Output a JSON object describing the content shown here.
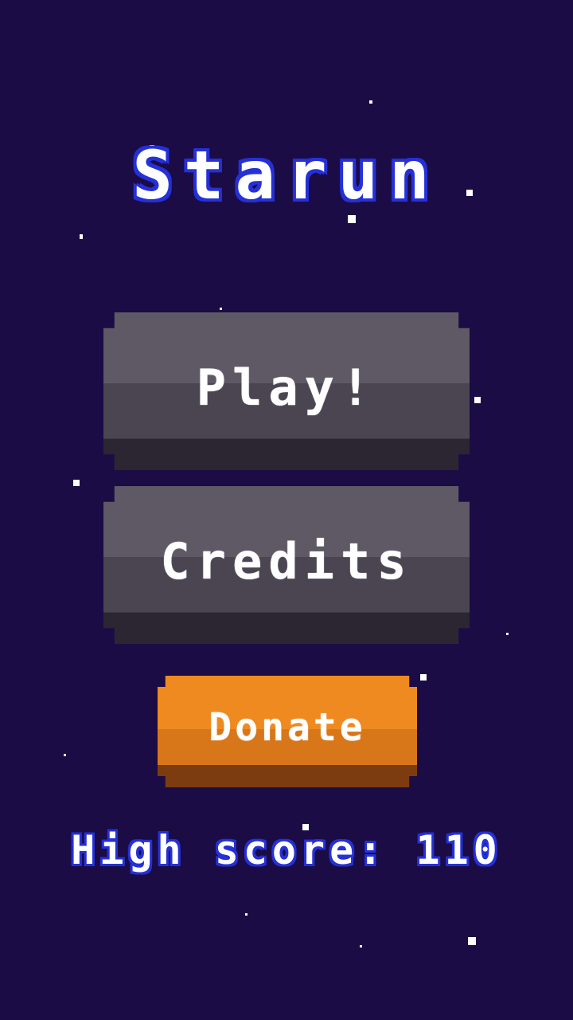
{
  "game": {
    "title": "Starun"
  },
  "menu": {
    "play_label": "Play!",
    "credits_label": "Credits",
    "donate_label": "Donate"
  },
  "score": {
    "label": "High score:",
    "value": "110"
  },
  "colors": {
    "background": "#1b0c45",
    "title_outline": "#2530d8",
    "button_gray": "#5f5966",
    "button_orange": "#ee8a1f"
  }
}
